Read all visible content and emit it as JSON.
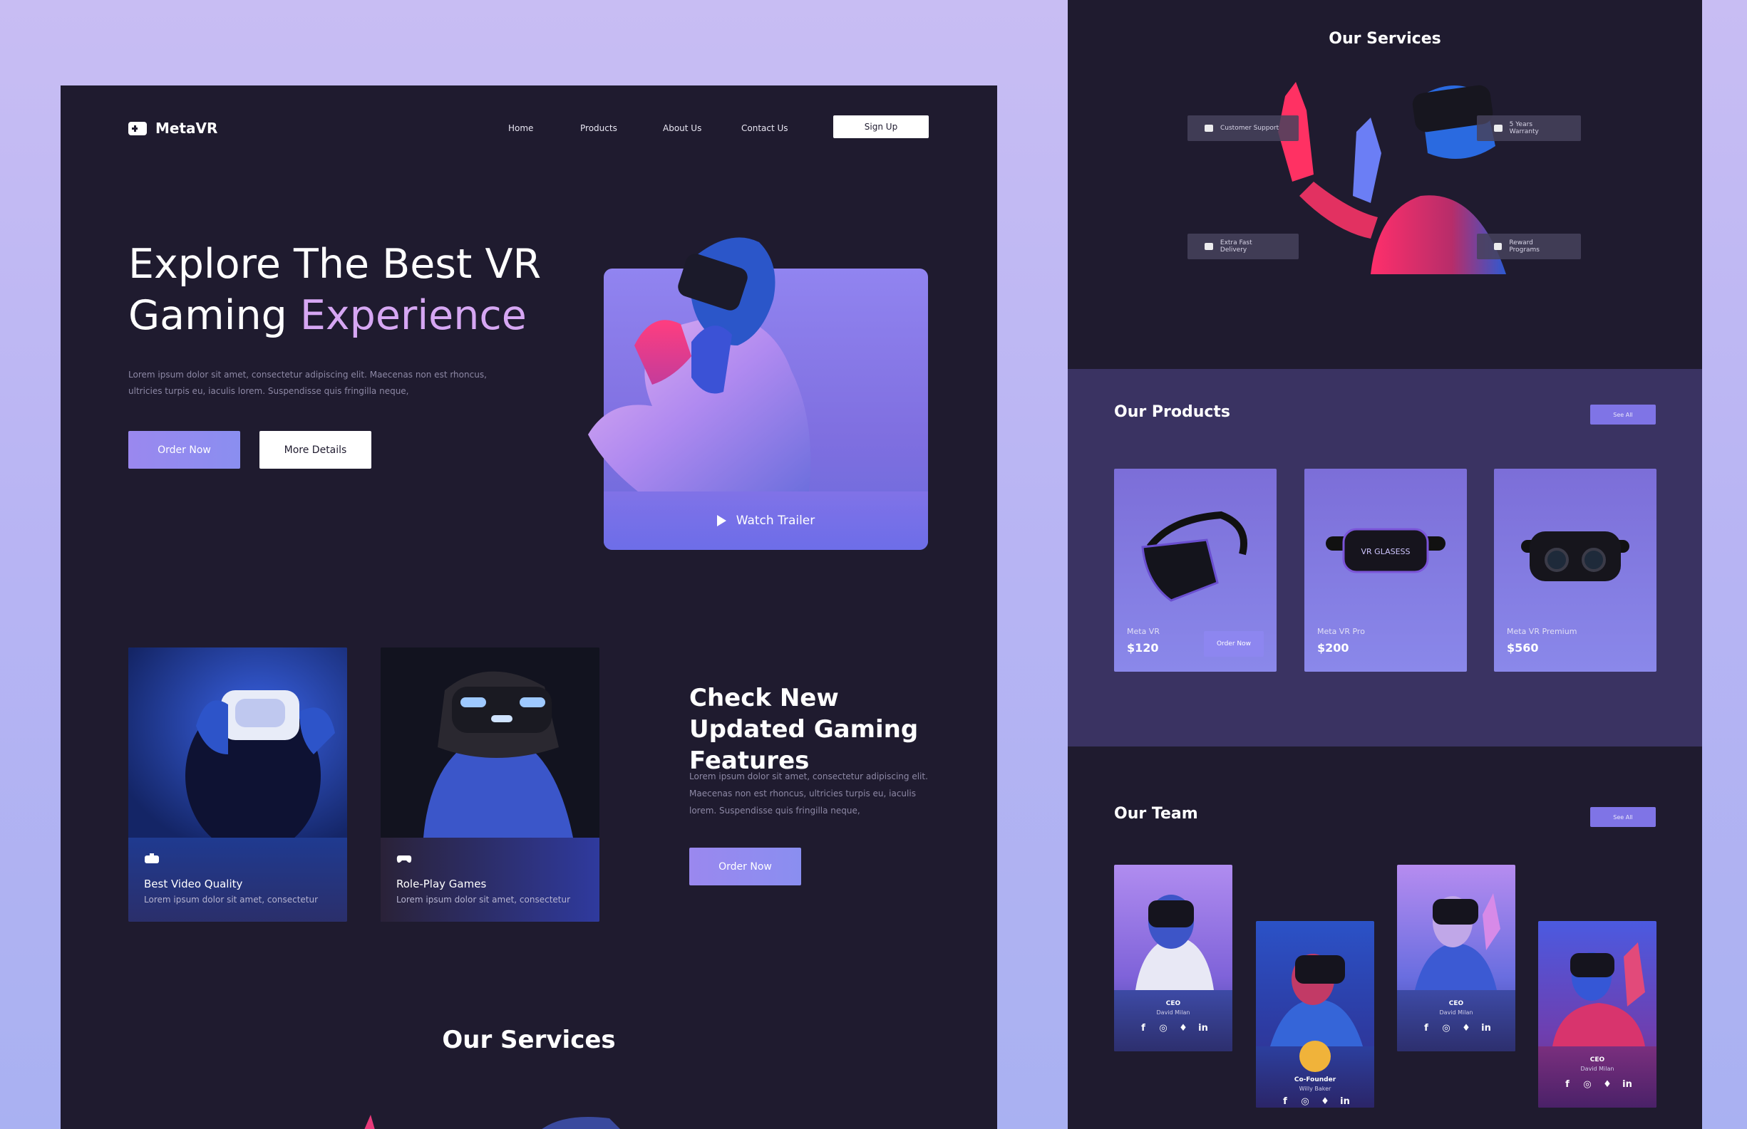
{
  "brand": {
    "name": "MetaVR"
  },
  "nav": {
    "home": "Home",
    "products": "Products",
    "about": "About Us",
    "contact": "Contact Us",
    "signup": "Sign Up"
  },
  "hero": {
    "title_line1": "Explore The Best VR",
    "title_line2_plain": "Gaming ",
    "title_line2_accent": "Experience",
    "text": "Lorem ipsum dolor sit amet, consectetur adipiscing elit. Maecenas non est rhoncus, ultricies turpis eu, iaculis lorem. Suspendisse quis fringilla neque,",
    "order_btn": "Order Now",
    "more_btn": "More Details",
    "watch": "Watch Trailer"
  },
  "features": [
    {
      "title": "Best Video Quality",
      "sub": "Lorem ipsum dolor sit amet, consectetur",
      "icon": "vr-headset-icon"
    },
    {
      "title": "Role-Play Games",
      "sub": "Lorem ipsum dolor sit amet, consectetur",
      "icon": "gamepad-icon"
    }
  ],
  "updates": {
    "title": "Check New Updated Gaming Features",
    "text": "Lorem ipsum dolor sit amet, consectetur adipiscing elit. Maecenas non est rhoncus, ultricies turpis eu, iaculis lorem. Suspendisse quis fringilla neque,",
    "order_btn": "Order Now"
  },
  "services": {
    "title": "Our Services",
    "tags": [
      {
        "label": "Customer Support",
        "icon": "headphones-icon"
      },
      {
        "label": "5 Years Warranty",
        "icon": "car-icon"
      },
      {
        "label": "Extra Fast Delivery",
        "icon": "truck-icon"
      },
      {
        "label": "Reward Programs",
        "icon": "trophy-icon"
      }
    ]
  },
  "products": {
    "title": "Our Products",
    "see_all": "See All",
    "items": [
      {
        "name": "Meta VR",
        "price": "$120",
        "order": "Order Now"
      },
      {
        "name": "Meta VR Pro",
        "price": "$200",
        "label": "VR GLASESS"
      },
      {
        "name": "Meta VR Premium",
        "price": "$560"
      }
    ]
  },
  "team": {
    "title": "Our Team",
    "see_all": "See All",
    "members": [
      {
        "role": "CEO",
        "name": "David Milan"
      },
      {
        "role": "Co-Founder",
        "name": "Willy Baker"
      },
      {
        "role": "CEO",
        "name": "David Milan"
      },
      {
        "role": "CEO",
        "name": "David Milan"
      }
    ]
  },
  "colors": {
    "panel": "#1f1b2f",
    "accent": "#d6a7f3",
    "button": "#8f8bf0",
    "products_bg": "#3a3362"
  }
}
